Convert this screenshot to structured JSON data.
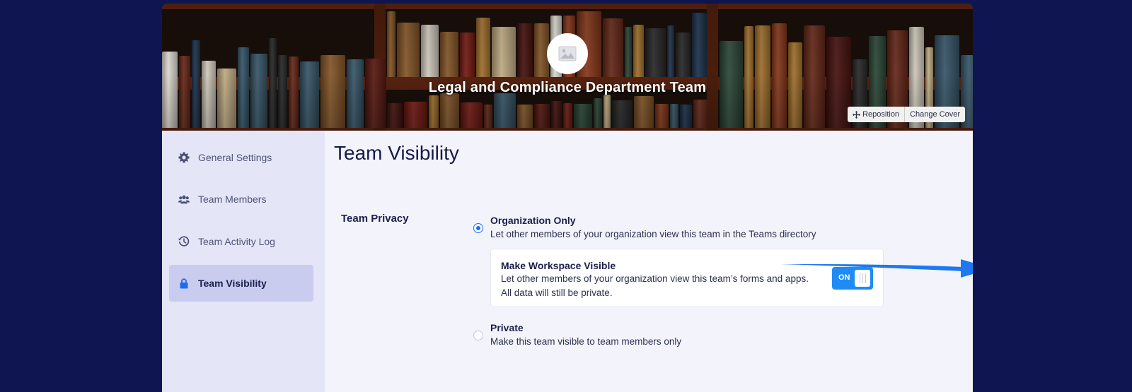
{
  "cover": {
    "team_name": "Legal and Compliance Department Team",
    "reposition_label": "Reposition",
    "change_cover_label": "Change Cover"
  },
  "sidebar": {
    "items": [
      {
        "label": "General Settings",
        "icon": "gear-icon",
        "active": false
      },
      {
        "label": "Team Members",
        "icon": "users-icon",
        "active": false
      },
      {
        "label": "Team Activity Log",
        "icon": "history-icon",
        "active": false
      },
      {
        "label": "Team Visibility",
        "icon": "lock-icon",
        "active": true
      }
    ]
  },
  "main": {
    "title": "Team Visibility",
    "section_label": "Team Privacy",
    "options": [
      {
        "title": "Organization Only",
        "description": "Let other members of your organization view this team in the Teams directory",
        "selected": true
      },
      {
        "title": "Private",
        "description": "Make this team visible to team members only",
        "selected": false
      }
    ],
    "workspace": {
      "title": "Make Workspace Visible",
      "description_line1": "Let other members of your organization view this team’s forms and apps.",
      "description_line2": "All data will still be private.",
      "toggle_label": "ON",
      "toggle_on": true
    }
  },
  "colors": {
    "page_background": "#0f1550",
    "accent": "#1d6cf0",
    "toggle": "#1f8cf5",
    "sidebar_active": "#c9ccee"
  }
}
